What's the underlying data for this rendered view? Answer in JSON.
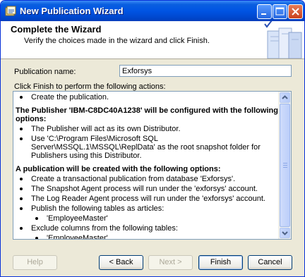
{
  "window": {
    "title": "New Publication Wizard"
  },
  "header": {
    "title": "Complete the Wizard",
    "subtitle": "Verify the choices made in the wizard and click Finish."
  },
  "form": {
    "publication_name_label": "Publication name:",
    "publication_name_value": "Exforsys",
    "actions_label": "Click Finish to perform the following actions:"
  },
  "actions": {
    "lines": [
      {
        "level": 1,
        "bold": false,
        "text": "Create the publication."
      },
      {
        "level": 0,
        "bold": true,
        "text": "The Publisher 'IBM-C8DC40A1238' will be configured with the following options:"
      },
      {
        "level": 1,
        "bold": false,
        "text": "The Publisher will act as its own Distributor."
      },
      {
        "level": 1,
        "bold": false,
        "text": "Use 'C:\\Program Files\\Microsoft SQL Server\\MSSQL.1\\MSSQL\\ReplData' as the root snapshot folder for Publishers using this Distributor."
      },
      {
        "level": 0,
        "bold": true,
        "text": "A publication will be created with the following options:"
      },
      {
        "level": 1,
        "bold": false,
        "text": "Create a transactional publication from database 'Exforsys'."
      },
      {
        "level": 1,
        "bold": false,
        "text": "The Snapshot Agent process will run under the 'exforsys' account."
      },
      {
        "level": 1,
        "bold": false,
        "text": "The Log Reader Agent process will run under the 'exforsys' account."
      },
      {
        "level": 1,
        "bold": false,
        "text": "Publish the following tables as articles:"
      },
      {
        "level": 2,
        "bold": false,
        "text": "'EmployeeMaster'"
      },
      {
        "level": 1,
        "bold": false,
        "text": "Exclude columns from the following tables:"
      },
      {
        "level": 2,
        "bold": false,
        "text": "'EmployeeMaster'"
      }
    ]
  },
  "buttons": {
    "help": "Help",
    "back": "< Back",
    "next": "Next >",
    "finish": "Finish",
    "cancel": "Cancel"
  },
  "icons": {
    "app": "wizard-icon",
    "minimize": "minimize-icon",
    "maximize": "maximize-icon",
    "close": "close-icon",
    "header_art": "checklist-books-icon",
    "scroll_up": "chevron-up-icon",
    "scroll_down": "chevron-down-icon"
  },
  "colors": {
    "titlebar": "#0054e3",
    "window_bg": "#ece9d8",
    "border": "#7f9db9"
  }
}
